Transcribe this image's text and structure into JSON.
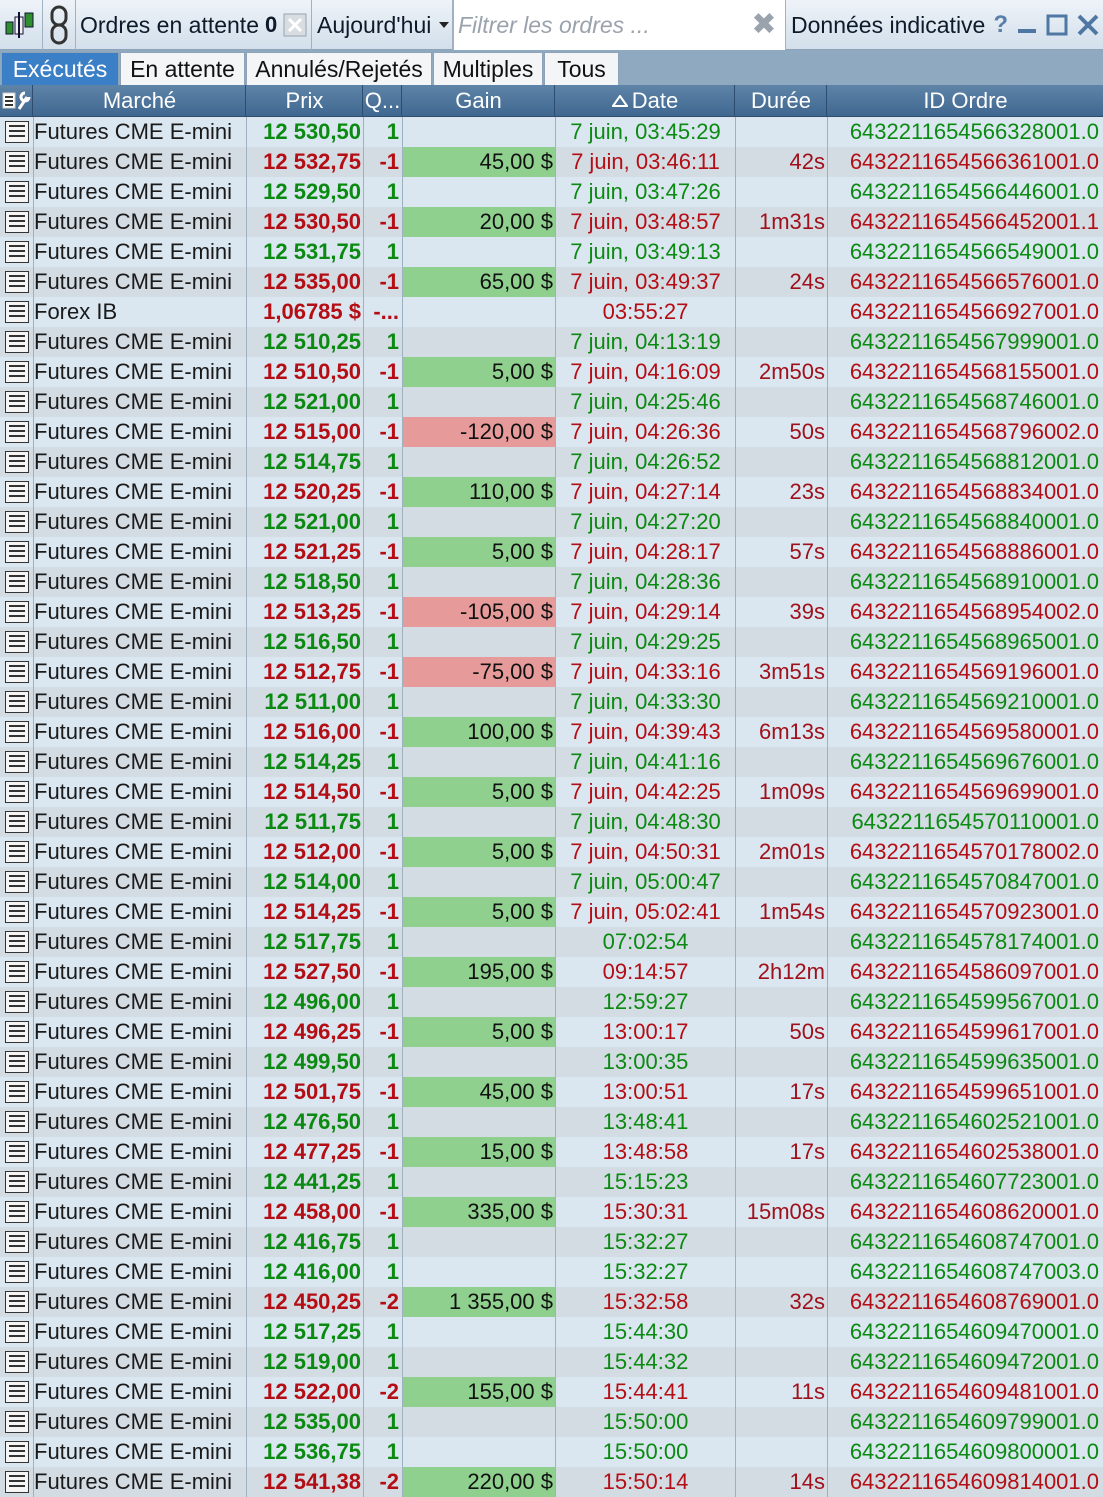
{
  "toolbar": {
    "pending_label": "Ordres en attente",
    "pending_count": "0",
    "date_range": "Aujourd'hui",
    "filter_placeholder": "Filtrer les ordres ...",
    "data_label": "Données indicative",
    "help": "?"
  },
  "tabs": [
    {
      "label": "Exécutés",
      "active": true
    },
    {
      "label": "En attente",
      "active": false
    },
    {
      "label": "Annulés/Rejetés",
      "active": false
    },
    {
      "label": "Multiples",
      "active": false
    },
    {
      "label": "Tous",
      "active": false
    }
  ],
  "columns": {
    "market": "Marché",
    "price": "Prix",
    "qty": "Q...",
    "gain": "Gain",
    "date": "Date",
    "duration": "Durée",
    "order_id": "ID Ordre"
  },
  "colors": {
    "buy": "#0b8a12",
    "sell": "#b50d14",
    "gain_positive_bg": "#8fd08f",
    "gain_negative_bg": "#e69a9a",
    "active_tab": "#3b7fc6"
  },
  "rows": [
    {
      "market": "Futures CME E-mini",
      "price": "12 530,50",
      "qty": "1",
      "gain": "",
      "date": "7 juin, 03:45:29",
      "duration": "",
      "id": "643221165456632800 1.0",
      "side": "buy"
    },
    {
      "market": "Futures CME E-mini",
      "price": "12 532,75",
      "qty": "-1",
      "gain": "45,00 $",
      "date": "7 juin, 03:46:11",
      "duration": "42s",
      "id": "6432211654566361001.0",
      "side": "sell"
    },
    {
      "market": "Futures CME E-mini",
      "price": "12 529,50",
      "qty": "1",
      "gain": "",
      "date": "7 juin, 03:47:26",
      "duration": "",
      "id": "6432211654566446001.0",
      "side": "buy"
    },
    {
      "market": "Futures CME E-mini",
      "price": "12 530,50",
      "qty": "-1",
      "gain": "20,00 $",
      "date": "7 juin, 03:48:57",
      "duration": "1m31s",
      "id": "6432211654566452001.1",
      "side": "sell"
    },
    {
      "market": "Futures CME E-mini",
      "price": "12 531,75",
      "qty": "1",
      "gain": "",
      "date": "7 juin, 03:49:13",
      "duration": "",
      "id": "6432211654566549001.0",
      "side": "buy"
    },
    {
      "market": "Futures CME E-mini",
      "price": "12 535,00",
      "qty": "-1",
      "gain": "65,00 $",
      "date": "7 juin, 03:49:37",
      "duration": "24s",
      "id": "6432211654566576001.0",
      "side": "sell"
    },
    {
      "market": "Forex IB",
      "price": "1,06785 $",
      "qty": "-...",
      "gain": "",
      "date": "03:55:27",
      "duration": "",
      "id": "6432211654566927001.0",
      "side": "sell",
      "gain_kind": "none"
    },
    {
      "market": "Futures CME E-mini",
      "price": "12 510,25",
      "qty": "1",
      "gain": "",
      "date": "7 juin, 04:13:19",
      "duration": "",
      "id": "6432211654567999001.0",
      "side": "buy"
    },
    {
      "market": "Futures CME E-mini",
      "price": "12 510,50",
      "qty": "-1",
      "gain": "5,00 $",
      "date": "7 juin, 04:16:09",
      "duration": "2m50s",
      "id": "6432211654568155001.0",
      "side": "sell"
    },
    {
      "market": "Futures CME E-mini",
      "price": "12 521,00",
      "qty": "1",
      "gain": "",
      "date": "7 juin, 04:25:46",
      "duration": "",
      "id": "6432211654568746001.0",
      "side": "buy"
    },
    {
      "market": "Futures CME E-mini",
      "price": "12 515,00",
      "qty": "-1",
      "gain": "-120,00 $",
      "date": "7 juin, 04:26:36",
      "duration": "50s",
      "id": "6432211654568796002.0",
      "side": "sell"
    },
    {
      "market": "Futures CME E-mini",
      "price": "12 514,75",
      "qty": "1",
      "gain": "",
      "date": "7 juin, 04:26:52",
      "duration": "",
      "id": "6432211654568812001.0",
      "side": "buy"
    },
    {
      "market": "Futures CME E-mini",
      "price": "12 520,25",
      "qty": "-1",
      "gain": "110,00 $",
      "date": "7 juin, 04:27:14",
      "duration": "23s",
      "id": "6432211654568834001.0",
      "side": "sell"
    },
    {
      "market": "Futures CME E-mini",
      "price": "12 521,00",
      "qty": "1",
      "gain": "",
      "date": "7 juin, 04:27:20",
      "duration": "",
      "id": "6432211654568840001.0",
      "side": "buy"
    },
    {
      "market": "Futures CME E-mini",
      "price": "12 521,25",
      "qty": "-1",
      "gain": "5,00 $",
      "date": "7 juin, 04:28:17",
      "duration": "57s",
      "id": "6432211654568886001.0",
      "side": "sell"
    },
    {
      "market": "Futures CME E-mini",
      "price": "12 518,50",
      "qty": "1",
      "gain": "",
      "date": "7 juin, 04:28:36",
      "duration": "",
      "id": "6432211654568910001.0",
      "side": "buy"
    },
    {
      "market": "Futures CME E-mini",
      "price": "12 513,25",
      "qty": "-1",
      "gain": "-105,00 $",
      "date": "7 juin, 04:29:14",
      "duration": "39s",
      "id": "6432211654568954002.0",
      "side": "sell"
    },
    {
      "market": "Futures CME E-mini",
      "price": "12 516,50",
      "qty": "1",
      "gain": "",
      "date": "7 juin, 04:29:25",
      "duration": "",
      "id": "6432211654568965001.0",
      "side": "buy"
    },
    {
      "market": "Futures CME E-mini",
      "price": "12 512,75",
      "qty": "-1",
      "gain": "-75,00 $",
      "date": "7 juin, 04:33:16",
      "duration": "3m51s",
      "id": "6432211654569196001.0",
      "side": "sell"
    },
    {
      "market": "Futures CME E-mini",
      "price": "12 511,00",
      "qty": "1",
      "gain": "",
      "date": "7 juin, 04:33:30",
      "duration": "",
      "id": "6432211654569210001.0",
      "side": "buy"
    },
    {
      "market": "Futures CME E-mini",
      "price": "12 516,00",
      "qty": "-1",
      "gain": "100,00 $",
      "date": "7 juin, 04:39:43",
      "duration": "6m13s",
      "id": "6432211654569580001.0",
      "side": "sell"
    },
    {
      "market": "Futures CME E-mini",
      "price": "12 514,25",
      "qty": "1",
      "gain": "",
      "date": "7 juin, 04:41:16",
      "duration": "",
      "id": "6432211654569676001.0",
      "side": "buy"
    },
    {
      "market": "Futures CME E-mini",
      "price": "12 514,50",
      "qty": "-1",
      "gain": "5,00 $",
      "date": "7 juin, 04:42:25",
      "duration": "1m09s",
      "id": "6432211654569699001.0",
      "side": "sell"
    },
    {
      "market": "Futures CME E-mini",
      "price": "12 511,75",
      "qty": "1",
      "gain": "",
      "date": "7 juin, 04:48:30",
      "duration": "",
      "id": "6432211654570110001.0",
      "side": "buy"
    },
    {
      "market": "Futures CME E-mini",
      "price": "12 512,00",
      "qty": "-1",
      "gain": "5,00 $",
      "date": "7 juin, 04:50:31",
      "duration": "2m01s",
      "id": "6432211654570178002.0",
      "side": "sell"
    },
    {
      "market": "Futures CME E-mini",
      "price": "12 514,00",
      "qty": "1",
      "gain": "",
      "date": "7 juin, 05:00:47",
      "duration": "",
      "id": "6432211654570847001.0",
      "side": "buy"
    },
    {
      "market": "Futures CME E-mini",
      "price": "12 514,25",
      "qty": "-1",
      "gain": "5,00 $",
      "date": "7 juin, 05:02:41",
      "duration": "1m54s",
      "id": "6432211654570923001.0",
      "side": "sell"
    },
    {
      "market": "Futures CME E-mini",
      "price": "12 517,75",
      "qty": "1",
      "gain": "",
      "date": "07:02:54",
      "duration": "",
      "id": "6432211654578174001.0",
      "side": "buy"
    },
    {
      "market": "Futures CME E-mini",
      "price": "12 527,50",
      "qty": "-1",
      "gain": "195,00 $",
      "date": "09:14:57",
      "duration": "2h12m",
      "id": "6432211654586097001.0",
      "side": "sell"
    },
    {
      "market": "Futures CME E-mini",
      "price": "12 496,00",
      "qty": "1",
      "gain": "",
      "date": "12:59:27",
      "duration": "",
      "id": "6432211654599567001.0",
      "side": "buy"
    },
    {
      "market": "Futures CME E-mini",
      "price": "12 496,25",
      "qty": "-1",
      "gain": "5,00 $",
      "date": "13:00:17",
      "duration": "50s",
      "id": "6432211654599617001.0",
      "side": "sell"
    },
    {
      "market": "Futures CME E-mini",
      "price": "12 499,50",
      "qty": "1",
      "gain": "",
      "date": "13:00:35",
      "duration": "",
      "id": "6432211654599635001.0",
      "side": "buy"
    },
    {
      "market": "Futures CME E-mini",
      "price": "12 501,75",
      "qty": "-1",
      "gain": "45,00 $",
      "date": "13:00:51",
      "duration": "17s",
      "id": "6432211654599651001.0",
      "side": "sell"
    },
    {
      "market": "Futures CME E-mini",
      "price": "12 476,50",
      "qty": "1",
      "gain": "",
      "date": "13:48:41",
      "duration": "",
      "id": "6432211654602521001.0",
      "side": "buy"
    },
    {
      "market": "Futures CME E-mini",
      "price": "12 477,25",
      "qty": "-1",
      "gain": "15,00 $",
      "date": "13:48:58",
      "duration": "17s",
      "id": "6432211654602538001.0",
      "side": "sell"
    },
    {
      "market": "Futures CME E-mini",
      "price": "12 441,25",
      "qty": "1",
      "gain": "",
      "date": "15:15:23",
      "duration": "",
      "id": "6432211654607723001.0",
      "side": "buy"
    },
    {
      "market": "Futures CME E-mini",
      "price": "12 458,00",
      "qty": "-1",
      "gain": "335,00 $",
      "date": "15:30:31",
      "duration": "15m08s",
      "id": "6432211654608620001.0",
      "side": "sell"
    },
    {
      "market": "Futures CME E-mini",
      "price": "12 416,75",
      "qty": "1",
      "gain": "",
      "date": "15:32:27",
      "duration": "",
      "id": "6432211654608747001.0",
      "side": "buy"
    },
    {
      "market": "Futures CME E-mini",
      "price": "12 416,00",
      "qty": "1",
      "gain": "",
      "date": "15:32:27",
      "duration": "",
      "id": "6432211654608747003.0",
      "side": "buy"
    },
    {
      "market": "Futures CME E-mini",
      "price": "12 450,25",
      "qty": "-2",
      "gain": "1 355,00 $",
      "date": "15:32:58",
      "duration": "32s",
      "id": "6432211654608769001.0",
      "side": "sell"
    },
    {
      "market": "Futures CME E-mini",
      "price": "12 517,25",
      "qty": "1",
      "gain": "",
      "date": "15:44:30",
      "duration": "",
      "id": "6432211654609470001.0",
      "side": "buy"
    },
    {
      "market": "Futures CME E-mini",
      "price": "12 519,00",
      "qty": "1",
      "gain": "",
      "date": "15:44:32",
      "duration": "",
      "id": "6432211654609472001.0",
      "side": "buy"
    },
    {
      "market": "Futures CME E-mini",
      "price": "12 522,00",
      "qty": "-2",
      "gain": "155,00 $",
      "date": "15:44:41",
      "duration": "11s",
      "id": "6432211654609481001.0",
      "side": "sell"
    },
    {
      "market": "Futures CME E-mini",
      "price": "12 535,00",
      "qty": "1",
      "gain": "",
      "date": "15:50:00",
      "duration": "",
      "id": "6432211654609799001.0",
      "side": "buy"
    },
    {
      "market": "Futures CME E-mini",
      "price": "12 536,75",
      "qty": "1",
      "gain": "",
      "date": "15:50:00",
      "duration": "",
      "id": "6432211654609800001.0",
      "side": "buy"
    },
    {
      "market": "Futures CME E-mini",
      "price": "12 541,38",
      "qty": "-2",
      "gain": "220,00 $",
      "date": "15:50:14",
      "duration": "14s",
      "id": "6432211654609814001.0",
      "side": "sell"
    }
  ]
}
